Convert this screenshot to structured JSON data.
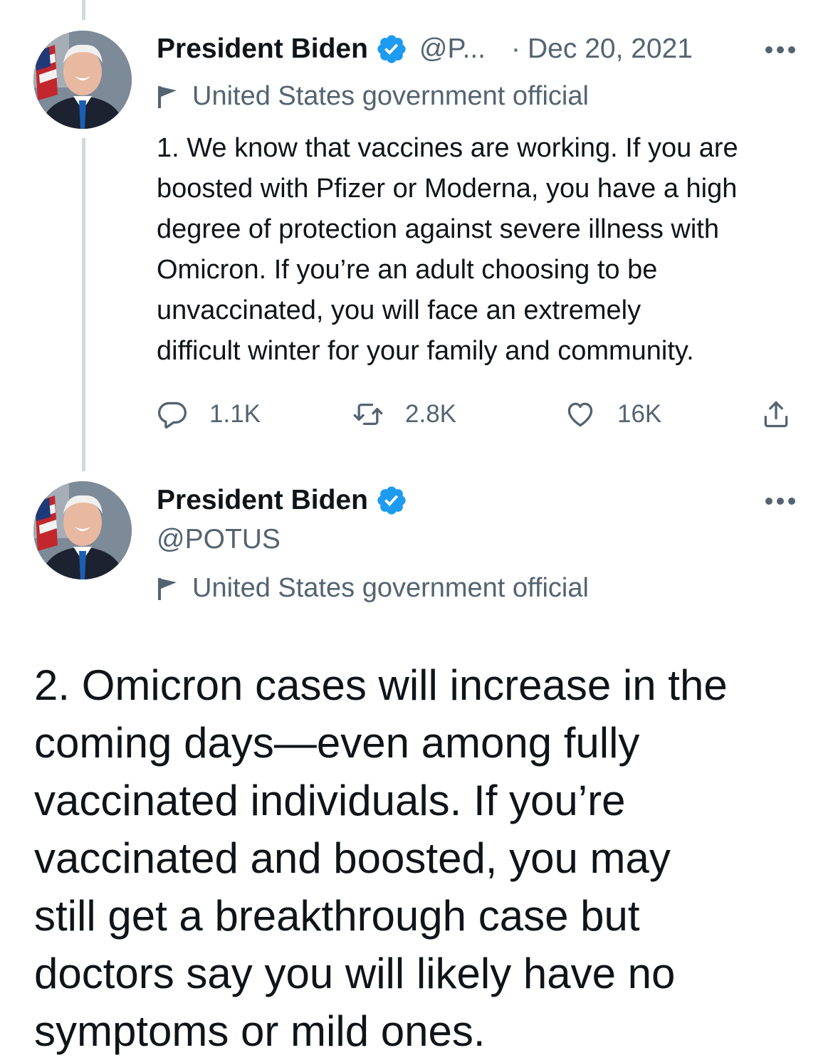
{
  "thread": [
    {
      "author": {
        "name": "President Biden",
        "handle": "@P...",
        "label": "United States government official",
        "avatar_icon": "president-portrait-avatar"
      },
      "date_separator": "·",
      "date": "Dec 20, 2021",
      "text": "1. We know that vaccines are working. If you are\nboosted with Pfizer or Moderna, you have a high\ndegree of protection against severe illness with\nOmicron. If you’re an adult choosing to be\nunvaccinated, you will face an extremely\ndifficult winter for your family and community.",
      "actions": {
        "reply_count": "1.1K",
        "retweet_count": "2.8K",
        "like_count": "16K",
        "reply_icon": "reply-icon",
        "retweet_icon": "retweet-icon",
        "like_icon": "heart-icon",
        "share_icon": "share-icon"
      }
    },
    {
      "author": {
        "name": "President Biden",
        "handle": "@POTUS",
        "label": "United States government official",
        "avatar_icon": "president-portrait-avatar"
      },
      "text": "2. Omicron cases will increase in the\ncoming days—even among fully\nvaccinated individuals. If you’re\nvaccinated and boosted, you may\nstill get a breakthrough case but\ndoctors say you will likely have no\nsymptoms or mild ones."
    }
  ],
  "colors": {
    "text_primary": "#0f1419",
    "text_secondary": "#536471",
    "verified_blue": "#1d9bf0",
    "thread_line": "#cfd9de"
  }
}
